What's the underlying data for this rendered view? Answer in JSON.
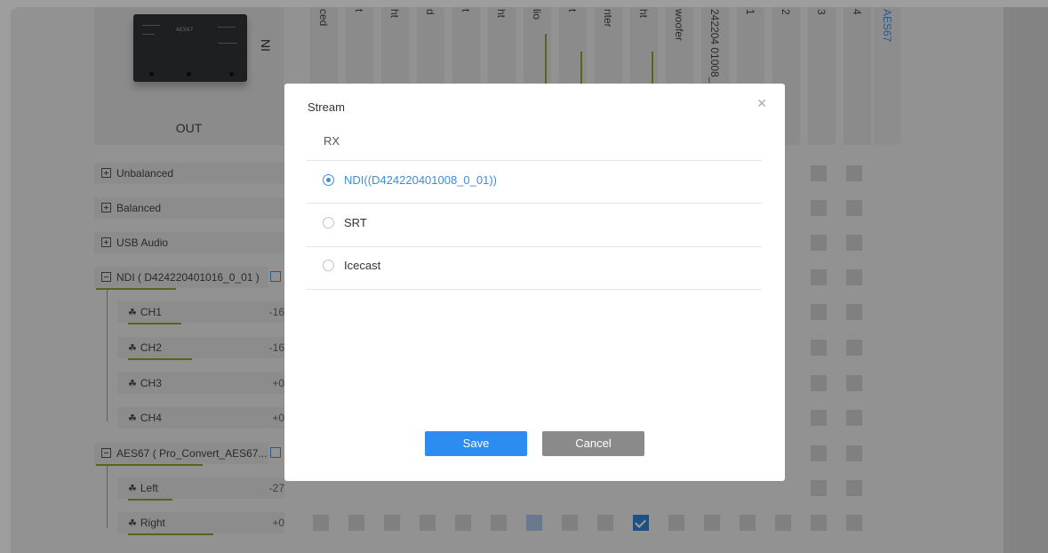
{
  "matrix": {
    "out_label": "OUT",
    "ni_label": "NI",
    "device_label": "AES67",
    "column_headers": [
      "ced",
      "t",
      "ht",
      "d",
      "t",
      "ht",
      "lio",
      "t",
      "nter",
      "ht",
      "woofer",
      "242204 01008_(",
      "1",
      "2",
      "3",
      "4"
    ],
    "aes_column": "AES67",
    "groups": [
      {
        "label": "Unbalanced",
        "expanded": false
      },
      {
        "label": "Balanced",
        "expanded": false
      },
      {
        "label": "USB Audio",
        "expanded": false
      },
      {
        "label": "NDI ( D424220401016_0_01 )",
        "expanded": true
      },
      {
        "label": "AES67 ( Pro_Convert_AES67...",
        "expanded": true
      }
    ],
    "channels": [
      {
        "label": "CH1",
        "level": "-16"
      },
      {
        "label": "CH2",
        "level": "-16"
      },
      {
        "label": "CH3",
        "level": "+0"
      },
      {
        "label": "CH4",
        "level": "+0"
      },
      {
        "label": "Left",
        "level": "-27"
      },
      {
        "label": "Right",
        "level": "+0"
      }
    ],
    "accent_color": "#2f84d4",
    "meter_color": "#8ba42a"
  },
  "dialog": {
    "title": "Stream",
    "close_icon": "close-icon",
    "section": "RX",
    "options": [
      {
        "label": "NDI((D424220401008_0_01))",
        "selected": true
      },
      {
        "label": "SRT",
        "selected": false
      },
      {
        "label": "Icecast",
        "selected": false
      }
    ],
    "save_label": "Save",
    "cancel_label": "Cancel",
    "save_color": "#2d8cf0",
    "cancel_color": "#8a8a8a"
  }
}
